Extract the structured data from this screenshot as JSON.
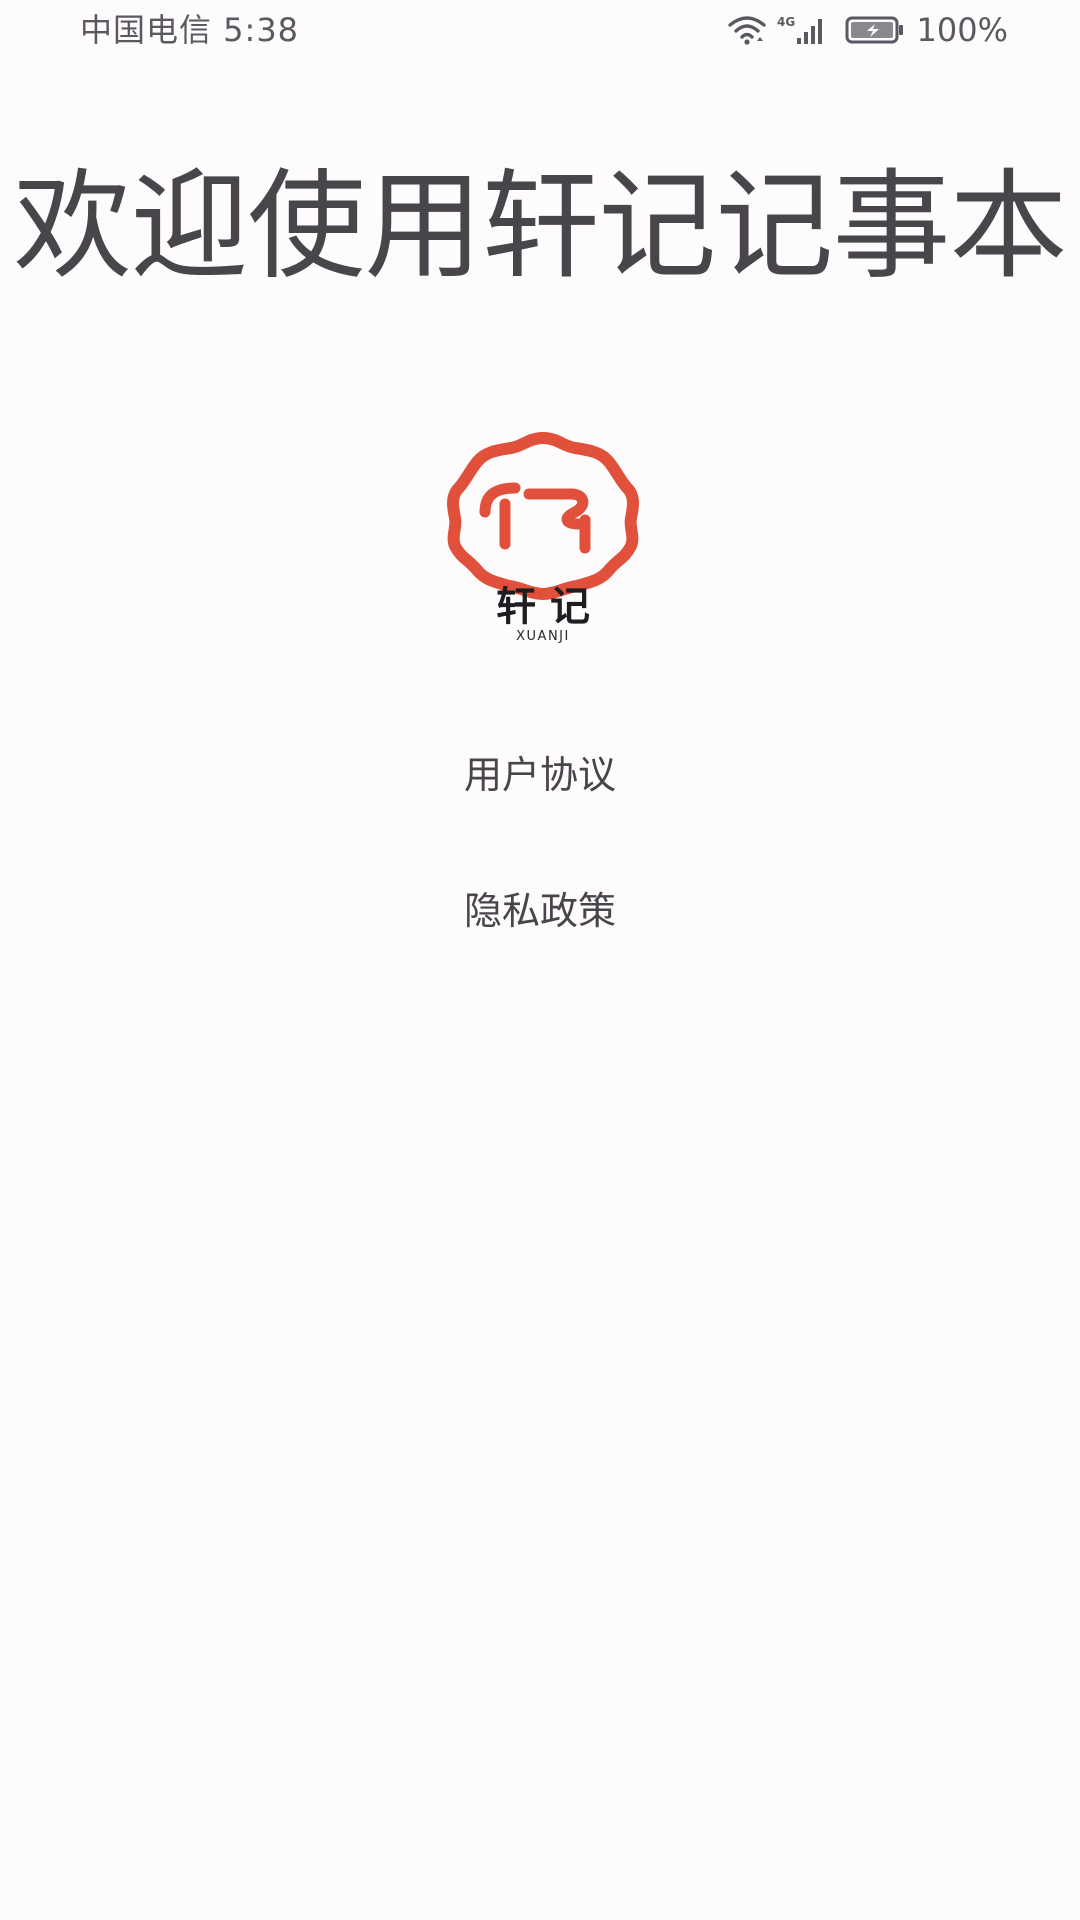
{
  "status_bar": {
    "carrier_time": "中国电信 5:38",
    "network_type": "4G",
    "battery_percent": "100%",
    "icons": [
      "wifi-icon",
      "signal-icon",
      "battery-charging-icon"
    ]
  },
  "welcome": {
    "title": "欢迎使用轩记记事本"
  },
  "logo": {
    "name_cn": "轩 记",
    "name_en": "XUANJI",
    "accent_color": "#e0503a"
  },
  "links": {
    "user_agreement": "用户协议",
    "privacy_policy": "隐私政策"
  }
}
